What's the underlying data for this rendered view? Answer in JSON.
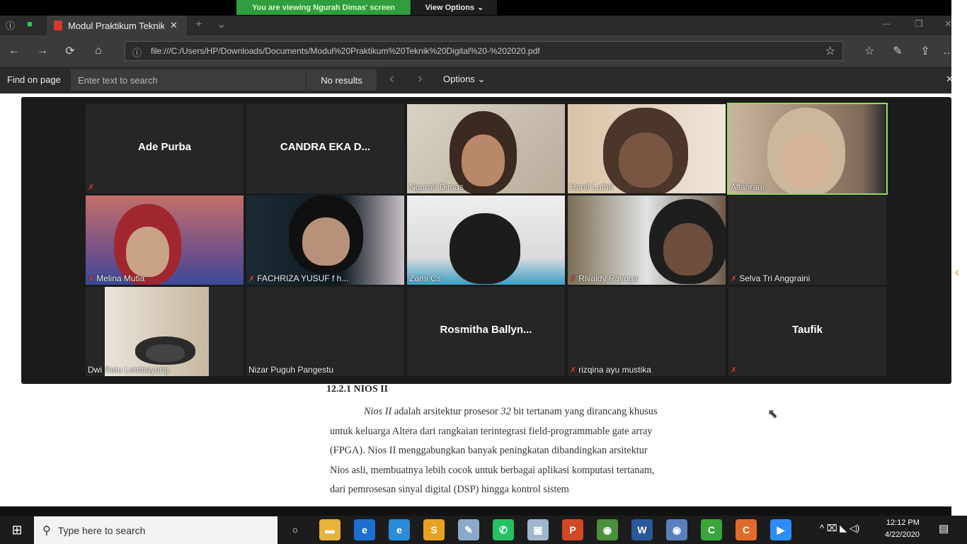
{
  "share": {
    "banner": "You are viewing Ngurah Dimas' screen",
    "view_options": "View Options",
    "chevron": "⌄"
  },
  "browser": {
    "tab_title": "Modul Praktikum Teknik",
    "url": "file:///C:/Users/HP/Downloads/Documents/Modul%20Praktikum%20Teknik%20Digital%20-%202020.pdf",
    "icons": {
      "back": "←",
      "forward": "→",
      "refresh": "⟳",
      "home": "⌂",
      "info": "ⓘ",
      "favorite": "☆",
      "favorites_list": "☆",
      "pen": "✎",
      "share": "⇪",
      "more": "…",
      "close_tab": "✕",
      "new_tab": "+",
      "tab_list": "⌄",
      "minimize": "—",
      "restore": "❐",
      "close": "✕"
    }
  },
  "find": {
    "label": "Find on page",
    "placeholder": "Enter text to search",
    "results": "No results",
    "prev": "‹",
    "next": "›",
    "options": "Options",
    "options_chevron": "⌄",
    "close": "✕"
  },
  "participants": [
    {
      "name": "Ade Purba",
      "camera": false,
      "muted": true,
      "show_label": false
    },
    {
      "name": "CANDRA EKA D...",
      "camera": false,
      "muted": false,
      "show_label": false
    },
    {
      "name": "Ngurah Dimas",
      "camera": true,
      "muted": false,
      "show_label": true
    },
    {
      "name": "Hanif Luthfi",
      "camera": true,
      "muted": false,
      "show_label": true
    },
    {
      "name": "Alfahrani",
      "camera": true,
      "muted": false,
      "show_label": true,
      "active_speaker": true
    },
    {
      "name": "Melina Mutia",
      "camera": true,
      "muted": true,
      "show_label": true
    },
    {
      "name": "FACHRIZA YUSUF f h...",
      "camera": true,
      "muted": true,
      "show_label": true
    },
    {
      "name": "Zami Cs",
      "camera": true,
      "muted": false,
      "show_label": true
    },
    {
      "name": "Rivaldy Rayoga",
      "camera": true,
      "muted": true,
      "show_label": true
    },
    {
      "name": "Selva Tri Anggraini",
      "camera": false,
      "muted": true,
      "show_label": true
    },
    {
      "name": "Dwi Ratu Lembayung",
      "camera": true,
      "muted": false,
      "show_label": true
    },
    {
      "name": "Nizar Puguh Pangestu",
      "camera": false,
      "muted": false,
      "show_label": true
    },
    {
      "name": "Rosmitha Ballyn...",
      "camera": false,
      "muted": false,
      "show_label": false
    },
    {
      "name": "rizqina ayu mustika",
      "camera": false,
      "muted": true,
      "show_label": true
    },
    {
      "name": "Taufik",
      "camera": false,
      "muted": true,
      "show_label": false
    }
  ],
  "document": {
    "heading": "12.2.1 NIOS II",
    "lines": [
      "Nios II adalah arsitektur prosesor 32 bit tertanam yang dirancang khusus",
      "untuk keluarga Altera dari rangkaian terintegrasi field-programmable gate array",
      "(FPGA). Nios II menggabungkan banyak peningkatan dibandingkan arsitektur",
      "Nios asli, membuatnya lebih cocok untuk berbagai aplikasi komputasi tertanam,",
      "dari pemrosesan sinyal digital (DSP) hingga kontrol sistem"
    ]
  },
  "taskbar": {
    "start": "⊞",
    "search_placeholder": "Type here to search",
    "search_icon": "⚲",
    "apps": [
      {
        "name": "task-view",
        "glyph": "○",
        "color": "#1c1c1c"
      },
      {
        "name": "file-explorer",
        "glyph": "▬",
        "color": "#e7b33d"
      },
      {
        "name": "edge",
        "glyph": "e",
        "color": "#1c6fd1"
      },
      {
        "name": "internet-explorer",
        "glyph": "e",
        "color": "#2a8bd8"
      },
      {
        "name": "sublime",
        "glyph": "S",
        "color": "#e8a121"
      },
      {
        "name": "notepad",
        "glyph": "✎",
        "color": "#8aa9c9"
      },
      {
        "name": "whatsapp",
        "glyph": "✆",
        "color": "#25c062"
      },
      {
        "name": "photos",
        "glyph": "▣",
        "color": "#9fb6cc"
      },
      {
        "name": "powerpoint",
        "glyph": "P",
        "color": "#d24726"
      },
      {
        "name": "chrome",
        "glyph": "◉",
        "color": "#4a8f3b"
      },
      {
        "name": "word",
        "glyph": "W",
        "color": "#2b579a"
      },
      {
        "name": "chrome-2",
        "glyph": "◉",
        "color": "#5a7fbf"
      },
      {
        "name": "camtasia-green",
        "glyph": "C",
        "color": "#3aa63a"
      },
      {
        "name": "camtasia-orange",
        "glyph": "C",
        "color": "#e06a2a"
      },
      {
        "name": "zoom",
        "glyph": "▶",
        "color": "#2d8cff"
      }
    ],
    "tray": "^ ⌧ ◣ ◁)",
    "time": "12:12 PM",
    "date": "4/22/2020",
    "notifications": "▤"
  },
  "sidebar": {
    "collapse_icon": "‹"
  }
}
